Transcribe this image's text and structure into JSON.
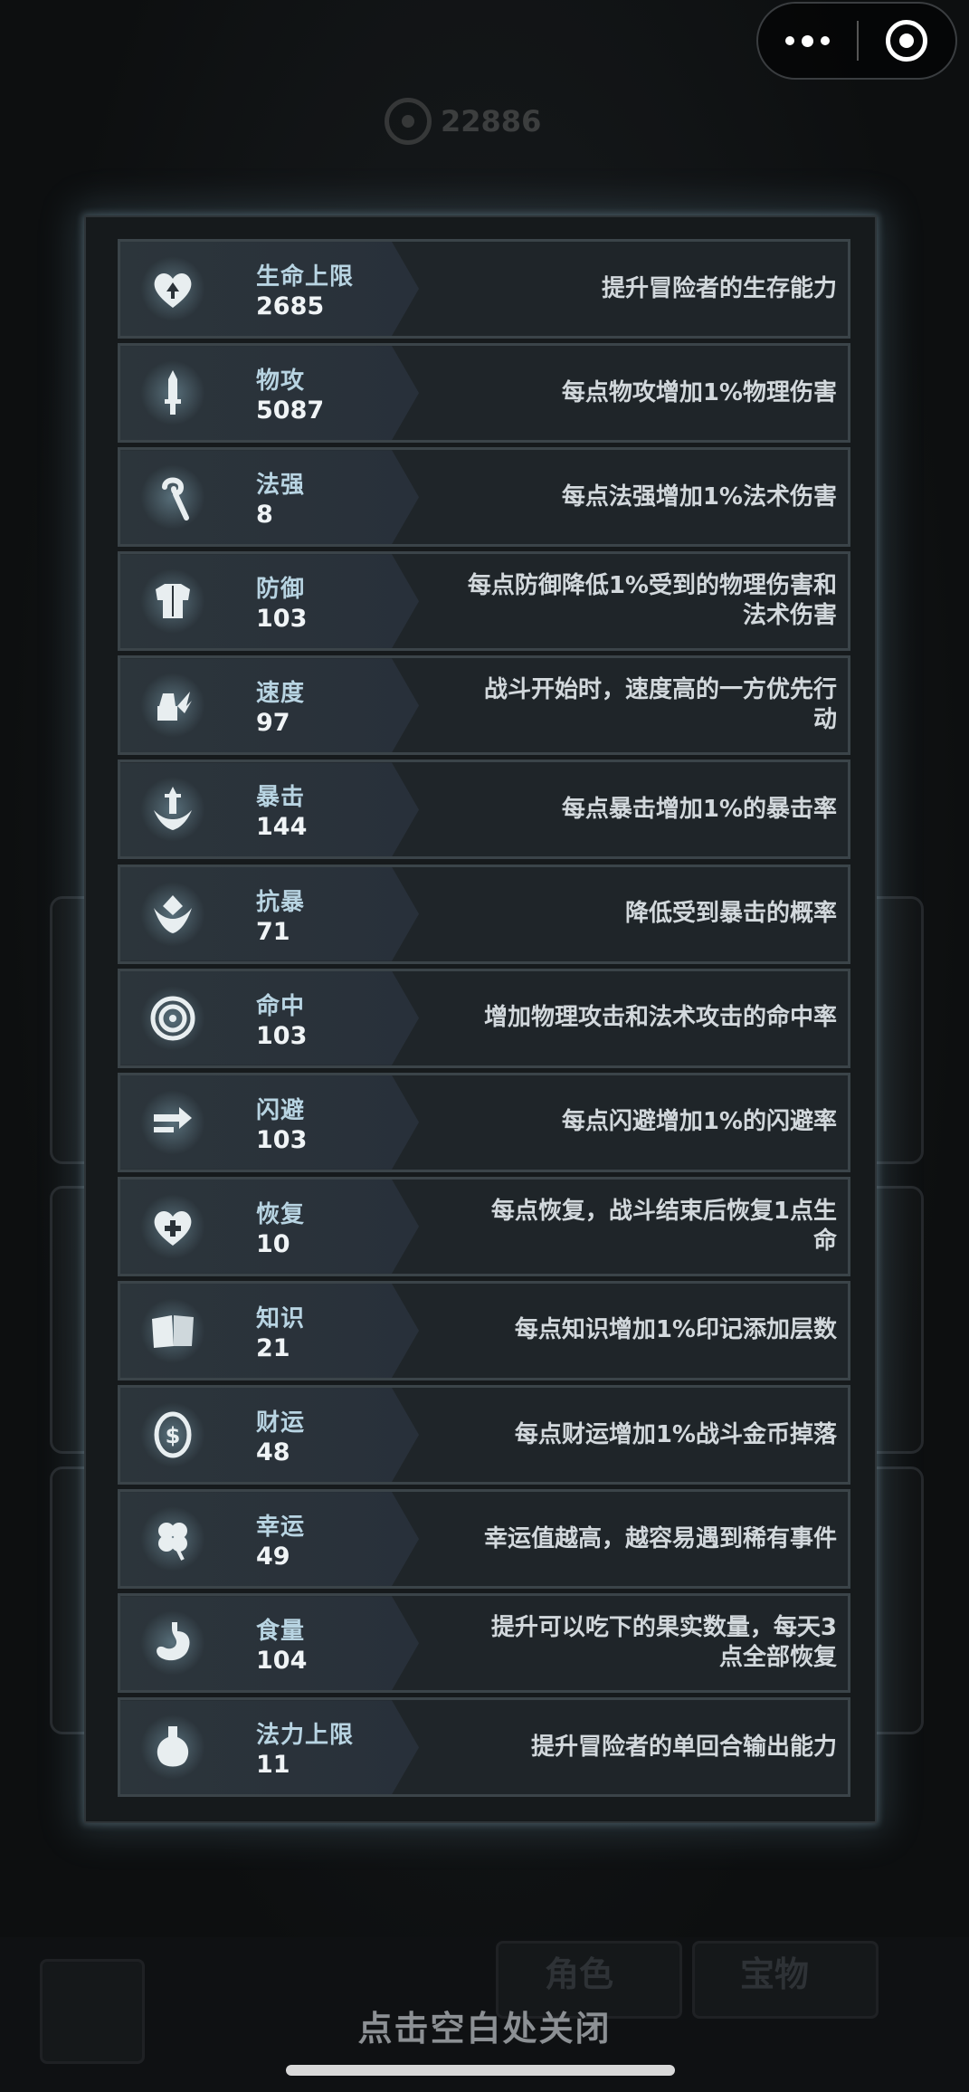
{
  "header": {
    "coins": "22886"
  },
  "capsule": {
    "more_icon": "more-dots-icon",
    "close_icon": "target-close-icon"
  },
  "stats": [
    {
      "icon": "heart-up-icon",
      "name": "生命上限",
      "value": "2685",
      "desc": "提升冒险者的生存能力"
    },
    {
      "icon": "sword-icon",
      "name": "物攻",
      "value": "5087",
      "desc": "每点物攻增加1%物理伤害"
    },
    {
      "icon": "staff-icon",
      "name": "法强",
      "value": "8",
      "desc": "每点法强增加1%法术伤害"
    },
    {
      "icon": "armor-icon",
      "name": "防御",
      "value": "103",
      "desc": "每点防御降低1%受到的物理伤害和\n法术伤害"
    },
    {
      "icon": "winged-boot-icon",
      "name": "速度",
      "value": "97",
      "desc": "战斗开始时，速度高的一方优先行\n动"
    },
    {
      "icon": "crit-sword-icon",
      "name": "暴击",
      "value": "144",
      "desc": "每点暴击增加1%的暴击率"
    },
    {
      "icon": "crit-shield-icon",
      "name": "抗暴",
      "value": "71",
      "desc": "降低受到暴击的概率"
    },
    {
      "icon": "target-icon",
      "name": "命中",
      "value": "103",
      "desc": "增加物理攻击和法术攻击的命中率"
    },
    {
      "icon": "dodge-arrows-icon",
      "name": "闪避",
      "value": "103",
      "desc": "每点闪避增加1%的闪避率"
    },
    {
      "icon": "heart-plus-icon",
      "name": "恢复",
      "value": "10",
      "desc": "每点恢复，战斗结束后恢复1点生\n命"
    },
    {
      "icon": "book-icon",
      "name": "知识",
      "value": "21",
      "desc": "每点知识增加1%印记添加层数"
    },
    {
      "icon": "dollar-coin-icon",
      "name": "财运",
      "value": "48",
      "desc": "每点财运增加1%战斗金币掉落"
    },
    {
      "icon": "clover-icon",
      "name": "幸运",
      "value": "49",
      "desc": "幸运值越高，越容易遇到稀有事件"
    },
    {
      "icon": "stomach-icon",
      "name": "食量",
      "value": "104",
      "desc": "提升可以吃下的果实数量，每天3\n点全部恢复"
    },
    {
      "icon": "mana-flask-icon",
      "name": "法力上限",
      "value": "11",
      "desc": "提升冒险者的单回合输出能力"
    }
  ],
  "bottom": {
    "tab_role": "角色",
    "tab_treasure": "宝物",
    "close_hint": "点击空白处关闭"
  }
}
